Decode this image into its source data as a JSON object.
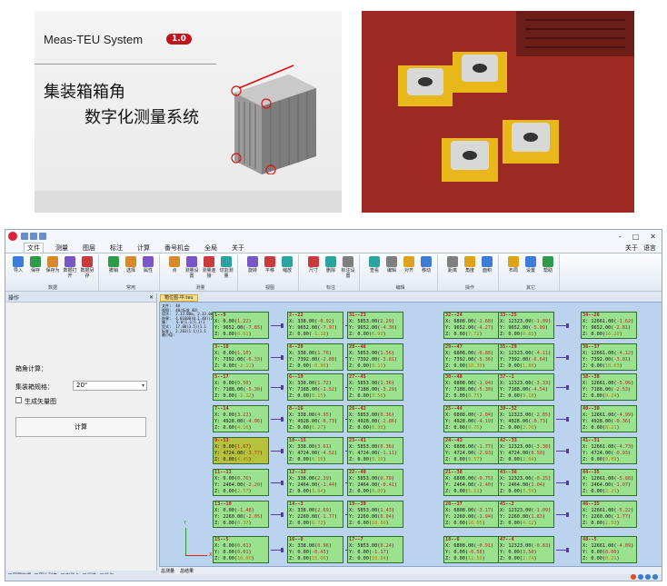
{
  "top": {
    "system_name": "Meas-TEU System",
    "version": "1.0",
    "title_line1": "集装箱箱角",
    "title_line2": "数字化测量系统"
  },
  "window": {
    "controls": [
      "-",
      "□",
      "✕"
    ]
  },
  "menu": {
    "items": [
      "文件",
      "测量",
      "图层",
      "标注",
      "计算",
      "番号机会",
      "全局",
      "关于"
    ],
    "right": [
      "关于",
      "语言"
    ]
  },
  "ribbon": {
    "groups": [
      {
        "label": "数据",
        "buttons": [
          "导入",
          "保存",
          "保存为",
          "数据打开",
          "数据另存"
        ]
      },
      {
        "label": "常用",
        "buttons": [
          "撤销",
          "选择",
          "属性"
        ]
      },
      {
        "label": "测量",
        "buttons": [
          "点",
          "测量设置",
          "测量连接",
          "切割测量"
        ]
      },
      {
        "label": "视图",
        "buttons": [
          "旋转",
          "平移",
          "缩放"
        ]
      },
      {
        "label": "标注",
        "buttons": [
          "尺寸",
          "删除",
          "标注设置"
        ]
      },
      {
        "label": "编辑",
        "buttons": [
          "查看",
          "编辑",
          "对齐",
          "移动"
        ]
      },
      {
        "label": "操作",
        "buttons": [
          "距离",
          "角度",
          "面积"
        ]
      },
      {
        "label": "其它",
        "buttons": [
          "布局",
          "设置",
          "帮助"
        ]
      }
    ]
  },
  "left_pane": {
    "title": "操作",
    "heading": "箱角计算：",
    "select_label": "集装箱规格：",
    "select_value": "20\"",
    "checkbox_label": "生成矢量图",
    "button": "计算",
    "tabs": [
      "图层管理",
      "图片列表",
      "实测点",
      "属性",
      "操作"
    ]
  },
  "document": {
    "tab": "箱位图-中.teu",
    "bottom_tabs": [
      "总测量",
      "总结果"
    ]
  },
  "canvas_info": "文件:  40\n视图:  40(标准 40)\n设计:  2.33.00m, 2.33.00m 2.33.00m\n结果:  4.01600(0.1.40)(2.34(2.6\n箱:    6.0(1.1(1.1(1\n型式:  17.00(3.5)(1.1\n标准:  2.203(1.1)(1.1\n最小值:",
  "cards": [
    {
      "id": "1--9",
      "x": "0.00",
      "xd": "1.22",
      "y": "9652.00",
      "yd": "-7.85",
      "z": "0.00",
      "zd": "0.01",
      "c": 0,
      "r": 0
    },
    {
      "id": "2--22",
      "x": "338.00",
      "xd": "-0.92",
      "y": "9652.00",
      "yd": "-7.97",
      "z": "0.00",
      "zd": "-1.18",
      "c": 1,
      "r": 0
    },
    {
      "id": "31--23",
      "x": "5853.00",
      "xd": "2.29",
      "y": "9652.00",
      "yd": "-4.30",
      "z": "0.00",
      "zd": "6.93",
      "c": 2,
      "r": 0
    },
    {
      "id": "32--24",
      "x": "6808.00",
      "xd": "-1.68",
      "y": "9652.00",
      "yd": "-4.27",
      "z": "0.00",
      "zd": "7.72",
      "c": 4,
      "r": 0
    },
    {
      "id": "33--25",
      "x": "12323.00",
      "xd": "-1.09",
      "y": "9652.00",
      "yd": "-5.09",
      "z": "0.00",
      "zd": "0.85",
      "c": 5,
      "r": 0
    },
    {
      "id": "34--26",
      "x": "12661.00",
      "xd": "-1.62",
      "y": "9652.00",
      "yd": "-2.81",
      "z": "0.00",
      "zd": "16.20",
      "c": 6,
      "r": 0
    },
    {
      "id": "3--18",
      "x": "0.00",
      "xd": "1.10",
      "y": "7392.00",
      "yd": "-6.33",
      "z": "0.00",
      "zd": "-2.11",
      "c": 0,
      "r": 1
    },
    {
      "id": "4--20",
      "x": "338.00",
      "xd": "1.76",
      "y": "7392.00",
      "yd": "-2.88",
      "z": "0.00",
      "zd": "-0.90",
      "c": 1,
      "r": 1
    },
    {
      "id": "28--46",
      "x": "5853.00",
      "xd": "1.56",
      "y": "7392.00",
      "yd": "-3.81",
      "z": "0.00",
      "zd": "9.11",
      "c": 2,
      "r": 1
    },
    {
      "id": "29--47",
      "x": "6808.00",
      "xd": "-0.88",
      "y": "7392.00",
      "yd": "-5.36",
      "z": "0.00",
      "zd": "10.30",
      "c": 4,
      "r": 1
    },
    {
      "id": "35--29",
      "x": "12323.00",
      "xd": "-4.11",
      "y": "7392.00",
      "yd": "-6.64",
      "z": "0.00",
      "zd": "1.88",
      "c": 5,
      "r": 1
    },
    {
      "id": "36--37",
      "x": "12661.00",
      "xd": "-4.12",
      "y": "7392.00",
      "yd": "-3.01",
      "z": "0.00",
      "zd": "10.03",
      "c": 6,
      "r": 1
    },
    {
      "id": "5--17",
      "x": "0.00",
      "xd": "0.50",
      "y": "7188.00",
      "yd": "-5.30",
      "z": "0.00",
      "zd": "-2.12",
      "c": 0,
      "r": 2
    },
    {
      "id": "6--19",
      "x": "338.00",
      "xd": "1.72",
      "y": "7188.00",
      "yd": "-1.52",
      "z": "0.00",
      "zd": "0.15",
      "c": 1,
      "r": 2
    },
    {
      "id": "27--45",
      "x": "5853.00",
      "xd": "1.36",
      "y": "7188.00",
      "yd": "-3.29",
      "z": "0.00",
      "zd": "3.58",
      "c": 2,
      "r": 2
    },
    {
      "id": "30--48",
      "x": "6808.00",
      "xd": "-1.94",
      "y": "7188.00",
      "yd": "-5.30",
      "z": "0.00",
      "zd": "8.75",
      "c": 4,
      "r": 2
    },
    {
      "id": "37--1",
      "x": "12323.00",
      "xd": "-3.33",
      "y": "7188.00",
      "yd": "-4.54",
      "z": "0.00",
      "zd": "9.18",
      "c": 5,
      "r": 2
    },
    {
      "id": "38--38",
      "x": "12661.00",
      "xd": "-5.06",
      "y": "7188.00",
      "yd": "-2.53",
      "z": "0.00",
      "zd": "9.24",
      "c": 6,
      "r": 2
    },
    {
      "id": "7--14",
      "x": "0.00",
      "xd": "3.22",
      "y": "4928.00",
      "yd": "-4.06",
      "z": "0.00",
      "zd": "4.16",
      "c": 0,
      "r": 3
    },
    {
      "id": "8--16",
      "x": "338.00",
      "xd": "4.95",
      "y": "4928.00",
      "yd": "-6.73",
      "z": "0.00",
      "zd": "6.27",
      "c": 1,
      "r": 3
    },
    {
      "id": "26--42",
      "x": "5853.00",
      "xd": "0.36",
      "y": "4928.00",
      "yd": "-2.86",
      "z": "0.00",
      "zd": "8.38",
      "c": 2,
      "r": 3
    },
    {
      "id": "25--44",
      "x": "6808.00",
      "xd": "-2.04",
      "y": "4928.00",
      "yd": "-4.19",
      "z": "0.00",
      "zd": "9.75",
      "c": 4,
      "r": 3
    },
    {
      "id": "39--32",
      "x": "12323.00",
      "xd": "-2.85",
      "y": "4928.00",
      "yd": "-0.73",
      "z": "0.00",
      "zd": "2.70",
      "c": 5,
      "r": 3
    },
    {
      "id": "40--30",
      "x": "12661.00",
      "xd": "-4.99",
      "y": "4928.00",
      "yd": "-0.36",
      "z": "0.00",
      "zd": "8.21",
      "c": 6,
      "r": 3
    },
    {
      "id": "9--13",
      "x": "0.00",
      "xd": "1.67",
      "y": "4724.00",
      "yd": "-3.77",
      "z": "0.00",
      "zd": "4.45",
      "c": 0,
      "r": 4,
      "sel": true
    },
    {
      "id": "10--15",
      "x": "338.00",
      "xd": "3.61",
      "y": "4724.00",
      "yd": "-4.52",
      "z": "0.00",
      "zd": "6.10",
      "c": 1,
      "r": 4
    },
    {
      "id": "23--41",
      "x": "5853.00",
      "xd": "0.36",
      "y": "4724.00",
      "yd": "-1.11",
      "z": "0.00",
      "zd": "9.16",
      "c": 2,
      "r": 4
    },
    {
      "id": "24--43",
      "x": "6808.00",
      "xd": "-1.77",
      "y": "4724.00",
      "yd": "-2.93",
      "z": "0.00",
      "zd": "9.57",
      "c": 4,
      "r": 4
    },
    {
      "id": "42--33",
      "x": "12323.00",
      "xd": "-3.38",
      "y": "4724.00",
      "yd": "0.50",
      "z": "0.00",
      "zd": "2.04",
      "c": 5,
      "r": 4
    },
    {
      "id": "41--31",
      "x": "12661.00",
      "xd": "-4.73",
      "y": "4724.00",
      "yd": "-0.93",
      "z": "0.00",
      "zd": "9.09",
      "c": 6,
      "r": 4
    },
    {
      "id": "11--11",
      "x": "0.00",
      "xd": "0.76",
      "y": "2464.00",
      "yd": "-2.20",
      "z": "0.00",
      "zd": "2.57",
      "c": 0,
      "r": 5
    },
    {
      "id": "12--12",
      "x": "338.00",
      "xd": "2.39",
      "y": "2464.00",
      "yd": "-1.44",
      "z": "0.00",
      "zd": "3.94",
      "c": 1,
      "r": 5
    },
    {
      "id": "22--40",
      "x": "5853.00",
      "xd": "0.78",
      "y": "2464.00",
      "yd": "-0.41",
      "z": "0.00",
      "zd": "0.00",
      "c": 2,
      "r": 5
    },
    {
      "id": "21--38",
      "x": "6808.00",
      "xd": "-0.75",
      "y": "2464.00",
      "yd": "-2.40",
      "z": "0.00",
      "zd": "1.11",
      "c": 4,
      "r": 5
    },
    {
      "id": "43--36",
      "x": "12323.00",
      "xd": "-0.25",
      "y": "2464.00",
      "yd": "1.04",
      "z": "0.00",
      "zd": "3.59",
      "c": 5,
      "r": 5
    },
    {
      "id": "44--35",
      "x": "12661.00",
      "xd": "-5.88",
      "y": "2464.00",
      "yd": "-1.07",
      "z": "0.00",
      "zd": "2.21",
      "c": 6,
      "r": 5
    },
    {
      "id": "13--10",
      "x": "0.00",
      "xd": "-1.48",
      "y": "2260.00",
      "yd": "-2.05",
      "z": "0.00",
      "zd": "0.37",
      "c": 0,
      "r": 6
    },
    {
      "id": "14--3",
      "x": "338.00",
      "xd": "2.69",
      "y": "2260.00",
      "yd": "-1.77",
      "z": "0.00",
      "zd": "6.73",
      "c": 1,
      "r": 6
    },
    {
      "id": "19--39",
      "x": "5853.00",
      "xd": "1.43",
      "y": "2260.00",
      "yd": "0.04",
      "z": "0.00",
      "zd": "10.80",
      "c": 2,
      "r": 6
    },
    {
      "id": "20--37",
      "x": "6808.00",
      "xd": "-3.17",
      "y": "2260.00",
      "yd": "-1.94",
      "z": "0.00",
      "zd": "16.05",
      "c": 4,
      "r": 6
    },
    {
      "id": "45--2",
      "x": "12323.00",
      "xd": "-1.09",
      "y": "2260.00",
      "yd": "1.83",
      "z": "0.00",
      "zd": "4.12",
      "c": 5,
      "r": 6
    },
    {
      "id": "46--35",
      "x": "12661.00",
      "xd": "-5.22",
      "y": "2260.00",
      "yd": "-1.77",
      "z": "0.00",
      "zd": "2.53",
      "c": 6,
      "r": 6
    },
    {
      "id": "15--5",
      "x": "0.00",
      "xd": "0.01",
      "y": "0.00",
      "yd": "0.01",
      "z": "0.00",
      "zd": "16.00",
      "c": 0,
      "r": 7
    },
    {
      "id": "16--8",
      "x": "338.00",
      "xd": "0.96",
      "y": "0.00",
      "yd": "-0.43",
      "z": "0.00",
      "zd": "15.00",
      "c": 1,
      "r": 7
    },
    {
      "id": "17--7",
      "x": "5853.00",
      "xd": "0.24",
      "y": "0.00",
      "yd": "-1.17",
      "z": "0.00",
      "zd": "10.84",
      "c": 2,
      "r": 7
    },
    {
      "id": "18--6",
      "x": "6808.00",
      "xd": "-0.91",
      "y": "0.00",
      "yd": "-0.58",
      "z": "0.00",
      "zd": "11.50",
      "c": 4,
      "r": 7
    },
    {
      "id": "47--4",
      "x": "12323.00",
      "xd": "-0.63",
      "y": "0.00",
      "yd": "3.50",
      "z": "0.00",
      "zd": "2.74",
      "c": 5,
      "r": 7
    },
    {
      "id": "48--5",
      "x": "12661.00",
      "xd": "-4.09",
      "y": "0.00",
      "yd": "0.00",
      "z": "0.00",
      "zd": "0.21",
      "c": 6,
      "r": 7
    }
  ],
  "axes": {
    "x_label": "X",
    "y_label": "Y"
  }
}
